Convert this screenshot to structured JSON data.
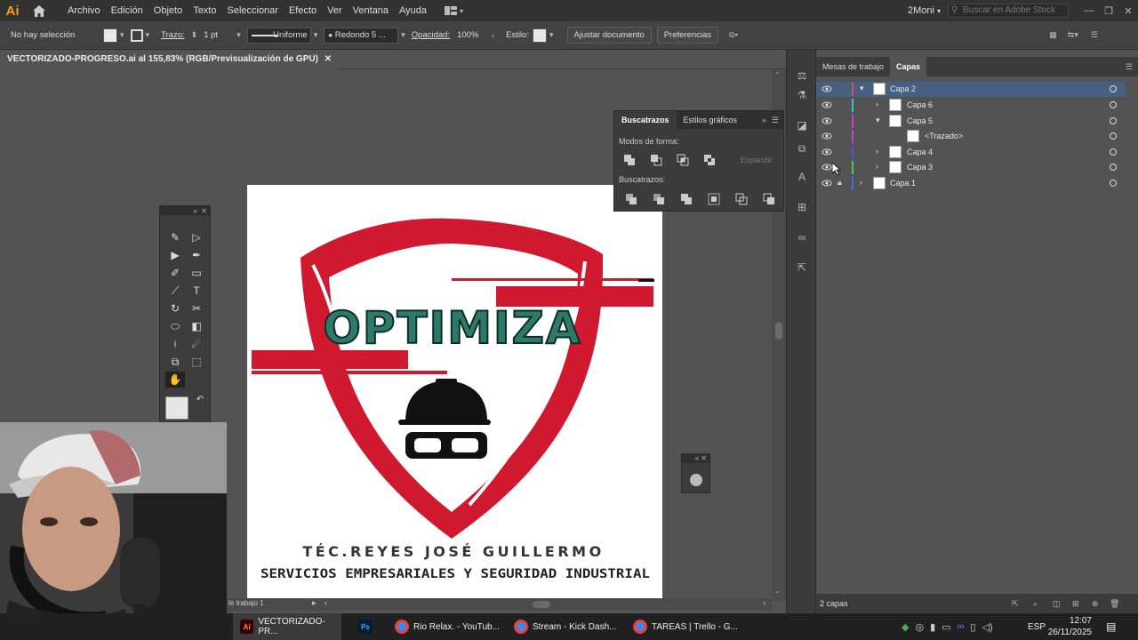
{
  "menubar": {
    "logo": "Ai",
    "menus": [
      "Archivo",
      "Edición",
      "Objeto",
      "Texto",
      "Seleccionar",
      "Efecto",
      "Ver",
      "Ventana",
      "Ayuda"
    ],
    "workspace": "2Moni",
    "search_placeholder": "Buscar en Adobe Stock"
  },
  "control": {
    "selection": "No hay selección",
    "stroke_label": "Trazo:",
    "stroke_value": "1 pt",
    "profile": "Uniforme",
    "brush": "Redondo 5 ...",
    "opacity_label": "Opacidad:",
    "opacity_value": "100%",
    "style_label": "Estilo:",
    "doc_setup": "Ajustar documento",
    "prefs": "Preferencias"
  },
  "document": {
    "tab_title": "VECTORIZADO-PROGRESO.ai al 155,83% (RGB/Previsualización de GPU)",
    "artboard_nav": "le trabajo 1"
  },
  "artwork": {
    "word": "OPTIMIZA",
    "line1": "TÉC.REYES JOSÉ GUILLERMO",
    "line2": "SERVICIOS EMPRESARIALES Y SEGURIDAD INDUSTRIAL",
    "colors": {
      "red": "#d0192f",
      "teal": "#2e7a6a",
      "black": "#111111"
    }
  },
  "pathfinder": {
    "tab_active": "Buscatrazos",
    "tab_other": "Estilos gráficos",
    "modes_label": "Modos de forma:",
    "expand_label": "Expandir",
    "pathfinders_label": "Buscatrazos:"
  },
  "layers_panel": {
    "tab_other": "Mesas de trabajo",
    "tab_active": "Capas",
    "rows": [
      {
        "name": "Capa 2",
        "color": "#e8464a",
        "selected": true
      },
      {
        "name": "Capa 6",
        "color": "#2fc6c6",
        "selected": false
      },
      {
        "name": "Capa 5",
        "color": "#d33ac9",
        "selected": false
      },
      {
        "name": "<Trazado>",
        "color": "#d33ac9",
        "selected": false
      },
      {
        "name": "Capa 4",
        "color": "#4a55d8",
        "selected": false
      },
      {
        "name": "Capa 3",
        "color": "#48c94a",
        "selected": false
      },
      {
        "name": "Capa 1",
        "color": "#4a6be0",
        "selected": false
      }
    ],
    "footer": "2 capas"
  },
  "taskbar": {
    "items": [
      {
        "label": "VECTORIZADO-PR...",
        "icon": "Ai"
      },
      {
        "label": "",
        "icon": "Ps"
      },
      {
        "label": "Rio Relax. - YouTub...",
        "icon": "chrome"
      },
      {
        "label": "Stream - Kick Dash...",
        "icon": "chrome"
      },
      {
        "label": "TAREAS | Trello - G...",
        "icon": "chrome"
      }
    ],
    "lang": "ESP",
    "time": "12:07",
    "date": "26/11/2025"
  }
}
